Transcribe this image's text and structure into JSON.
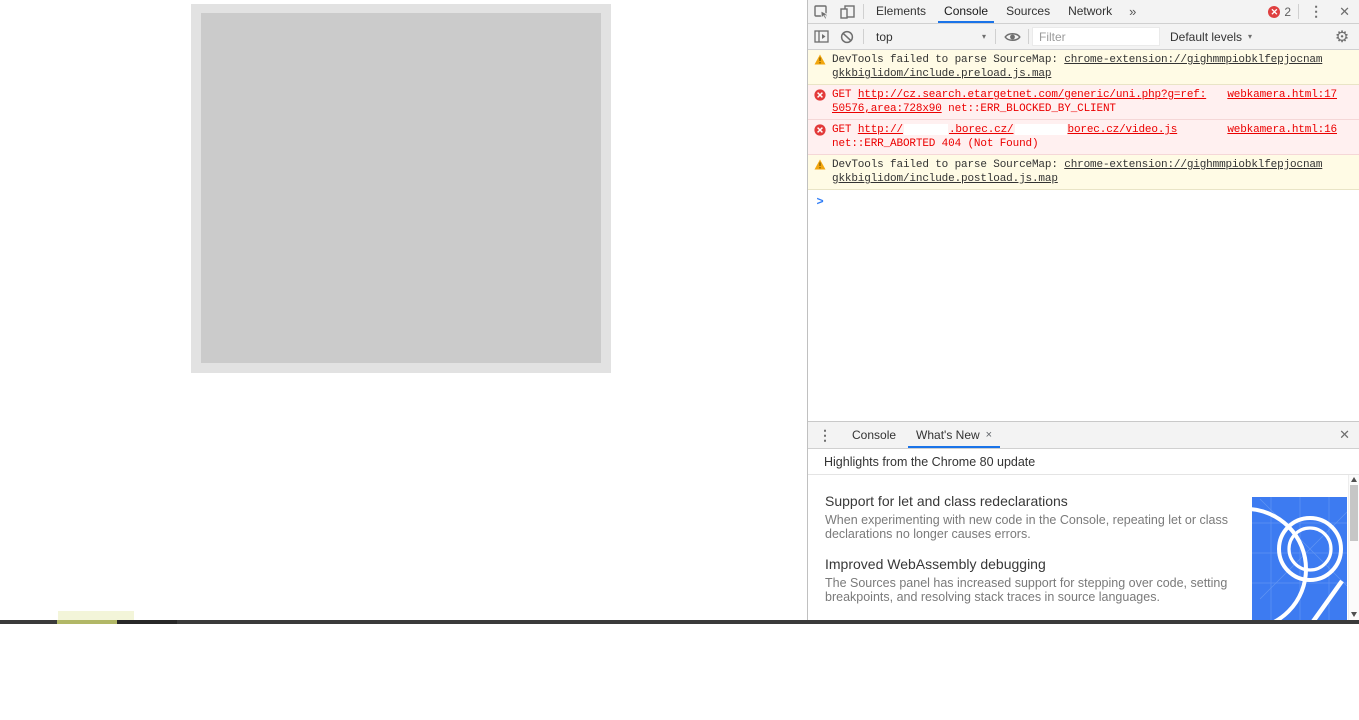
{
  "devtools": {
    "tabs": {
      "elements": "Elements",
      "console": "Console",
      "sources": "Sources",
      "network": "Network",
      "more": "»"
    },
    "error_badge_count": "2",
    "toolbar": {
      "context_selector": "top",
      "filter_placeholder": "Filter",
      "levels_label": "Default levels",
      "caret": "▾"
    },
    "console": {
      "m1": {
        "text": "DevTools failed to parse SourceMap: ",
        "link_line1": "chrome-extension://gighmmpiobklfepjocnam",
        "link_line2": "gkkbiglidom/include.preload.js.map"
      },
      "m2": {
        "method": "GET ",
        "url_line1": "http://cz.search.etargetnet.com/generic/uni.php?g=ref:",
        "url_line2": "50576,area:728x90",
        "status": " net::ERR_BLOCKED_BY_CLIENT",
        "source": "webkamera.html:17"
      },
      "m3": {
        "method": "GET ",
        "url_a": "http://",
        "url_b": ".borec.cz/",
        "url_c": "borec.cz/video.js",
        "status": "net::ERR_ABORTED 404 (Not Found)",
        "source": "webkamera.html:16"
      },
      "m4": {
        "text": "DevTools failed to parse SourceMap: ",
        "link_line1": "chrome-extension://gighmmpiobklfepjocnam",
        "link_line2": "gkkbiglidom/include.postload.js.map"
      },
      "prompt": ">"
    },
    "drawer": {
      "console_tab": "Console",
      "whats_new_tab": "What's New",
      "close_tab_x": "×",
      "header": "Highlights from the Chrome 80 update",
      "sections": [
        {
          "title": "Support for let and class redeclarations",
          "body": "When experimenting with new code in the Console, repeating let or class declarations no longer causes errors."
        },
        {
          "title": "Improved WebAssembly debugging",
          "body": "The Sources panel has increased support for stepping over code, setting breakpoints, and resolving stack traces in source languages."
        }
      ]
    }
  },
  "colors": {
    "accent_blue": "#1a73e8",
    "error_red": "#eb0000",
    "error_bg": "#fff0f0",
    "warning_bg": "#fffbe5",
    "warning_icon_orange": "#f2a60d",
    "artwork_blue": "#3d7bf1"
  },
  "glyphs": {
    "close": "✕",
    "kebab": "⋮"
  }
}
